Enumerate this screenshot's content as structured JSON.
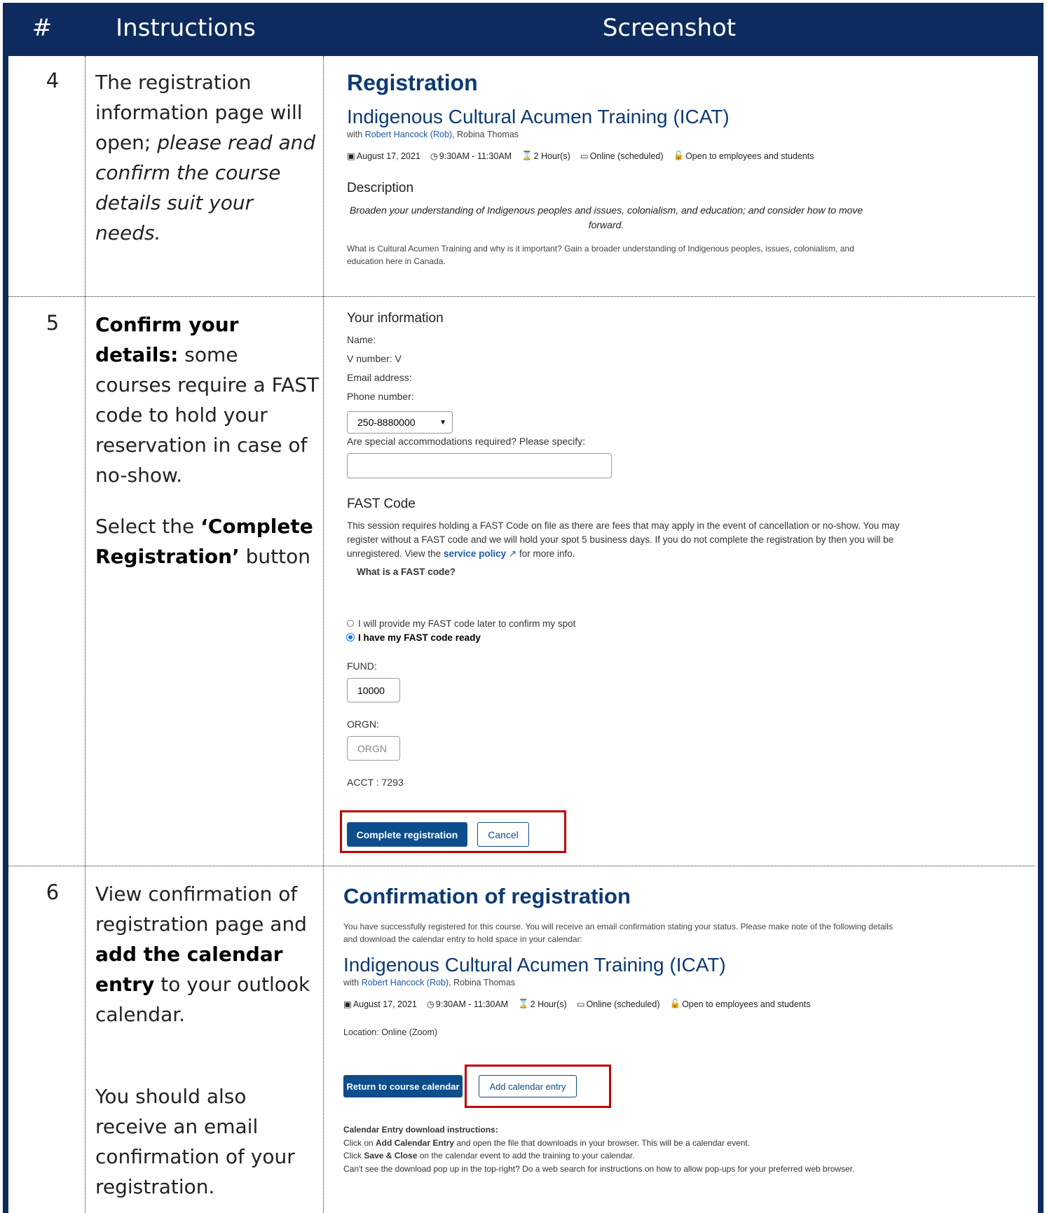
{
  "header": {
    "num": "#",
    "instructions": "Instructions",
    "screenshot": "Screenshot"
  },
  "rows": [
    {
      "num": "4",
      "num5": "5",
      "num6": "6"
    }
  ],
  "row4": {
    "instr_a": "The registration information page will open; ",
    "instr_b": "please read and confirm the course details suit your needs.",
    "title": "Registration",
    "course": "Indigenous Cultural Acumen Training (ICAT)",
    "with": "with ",
    "host": "Robert Hancock (Rob)",
    "cohost": ", Robina Thomas",
    "date": "August 17, 2021",
    "time": "9:30AM - 11:30AM",
    "duration": "2 Hour(s)",
    "mode": "Online (scheduled)",
    "open": "Open to employees and students",
    "desc_h": "Description",
    "desc_em": "Broaden your understanding of Indigenous peoples and issues, colonialism, and education; and consider how to move forward.",
    "desc_p": "What is Cultural Acumen Training and why is it important? Gain a broader understanding of Indigenous peoples, issues, colonialism, and education here in Canada."
  },
  "row5": {
    "instr_b1": "Confirm your details:",
    "instr_t1": " some courses require a FAST code to hold your reservation in case of no-show.",
    "instr_t2": "Select the ",
    "instr_b2": "‘Complete Registration’",
    "instr_t3": " button",
    "your_info": "Your information",
    "name": "Name:",
    "vnum": "V number: V",
    "email": "Email address:",
    "phone": "Phone number:",
    "phone_val": "250-8880000",
    "special": "Are special accommodations required? Please specify:",
    "fast_h": "FAST Code",
    "fast_p1": "This session requires holding a FAST Code on file as there are fees that may apply in the event of cancellation or no-show. You may register without a FAST code and we will hold your spot 5 business days. If you do not complete the registration by then you will be unregistered. View the ",
    "policy": "service policy",
    "fast_p2": " for more info.",
    "what_fast": "What is a FAST code?",
    "radio1": "I will provide my FAST code later to confirm my spot",
    "radio2": "I have my FAST code ready",
    "fund_l": "FUND:",
    "fund_v": "10000",
    "orgn_l": "ORGN:",
    "orgn_p": "ORGN",
    "acct": "ACCT : 7293",
    "complete": "Complete registration",
    "cancel": "Cancel"
  },
  "row6": {
    "instr_t1": "View confirmation of registration page and ",
    "instr_b1": "add the calendar entry",
    "instr_t2": " to your outlook calendar.",
    "instr_t3": "You should also receive an email confirmation of your registration.",
    "title": "Confirmation of registration",
    "success": "You have successfully registered for this course. You will receive an email confirmation stating your status. Please make note of the following details and download the calendar entry to hold space in your calendar:",
    "course": "Indigenous Cultural Acumen Training (ICAT)",
    "with": "with ",
    "host": "Robert Hancock (Rob)",
    "cohost": ", Robina Thomas",
    "date": "August 17, 2021",
    "time": "9:30AM - 11:30AM",
    "duration": "2 Hour(s)",
    "mode": "Online (scheduled)",
    "open": "Open to employees and students",
    "location": "Location: Online (Zoom)",
    "return": "Return to course calendar",
    "add": "Add calendar entry",
    "dl_h": "Calendar Entry download instructions:",
    "dl1a": "Click on ",
    "dl1b": "Add Calendar Entry",
    "dl1c": " and open the file that downloads in your browser. This will be a calendar event.",
    "dl2a": "Click ",
    "dl2b": "Save & Close",
    "dl2c": " on the calendar event to add the training to your calendar.",
    "dl3": "Can't see the download pop up in the top-right? Do a web search for instructions on how to allow pop-ups for your preferred web browser."
  }
}
